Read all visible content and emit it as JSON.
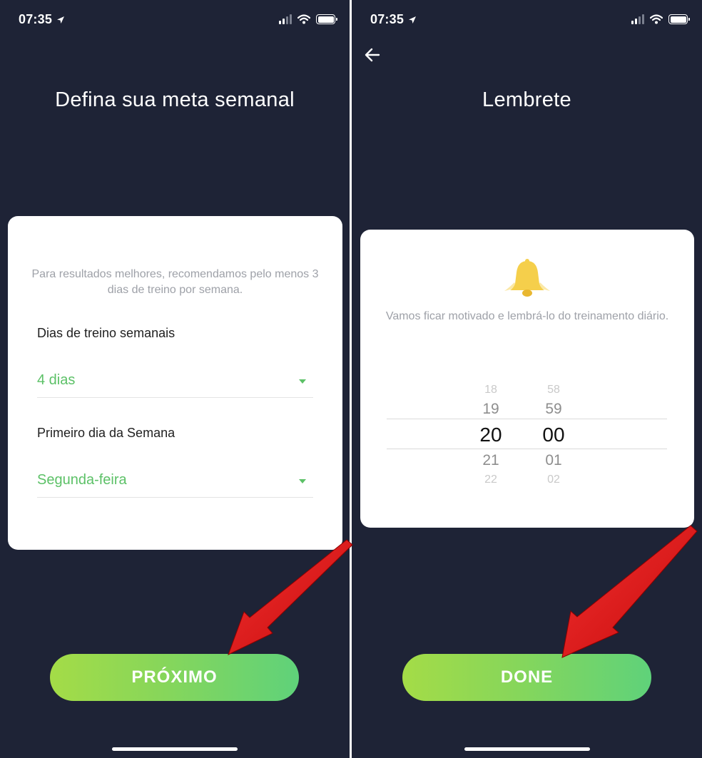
{
  "left": {
    "status": {
      "time": "07:35"
    },
    "title": "Defina sua meta semanal",
    "hint": "Para resultados melhores, recomendamos pelo menos 3 dias de treino por semana.",
    "days_label": "Dias de treino semanais",
    "days_value": "4 dias",
    "first_day_label": "Primeiro dia da Semana",
    "first_day_value": "Segunda-feira",
    "cta": "PRÓXIMO"
  },
  "right": {
    "status": {
      "time": "07:35"
    },
    "title": "Lembrete",
    "hint": "Vamos ficar motivado e lembrá-lo do treinamento diário.",
    "picker": {
      "hours": [
        "18",
        "19",
        "20",
        "21",
        "22"
      ],
      "minutes": [
        "58",
        "59",
        "00",
        "01",
        "02"
      ]
    },
    "cta": "DONE"
  },
  "colors": {
    "background": "#1e2336",
    "accent_green": "#5cc167",
    "button_gradient_start": "#a4dc47",
    "button_gradient_end": "#5fd27a",
    "bell": "#f5cf4b",
    "annotation_arrow": "#e01010"
  },
  "icons": [
    "location-arrow-icon",
    "signal-icon",
    "wifi-icon",
    "battery-icon",
    "back-arrow-icon",
    "caret-down-icon",
    "bell-icon",
    "annotation-arrow"
  ]
}
